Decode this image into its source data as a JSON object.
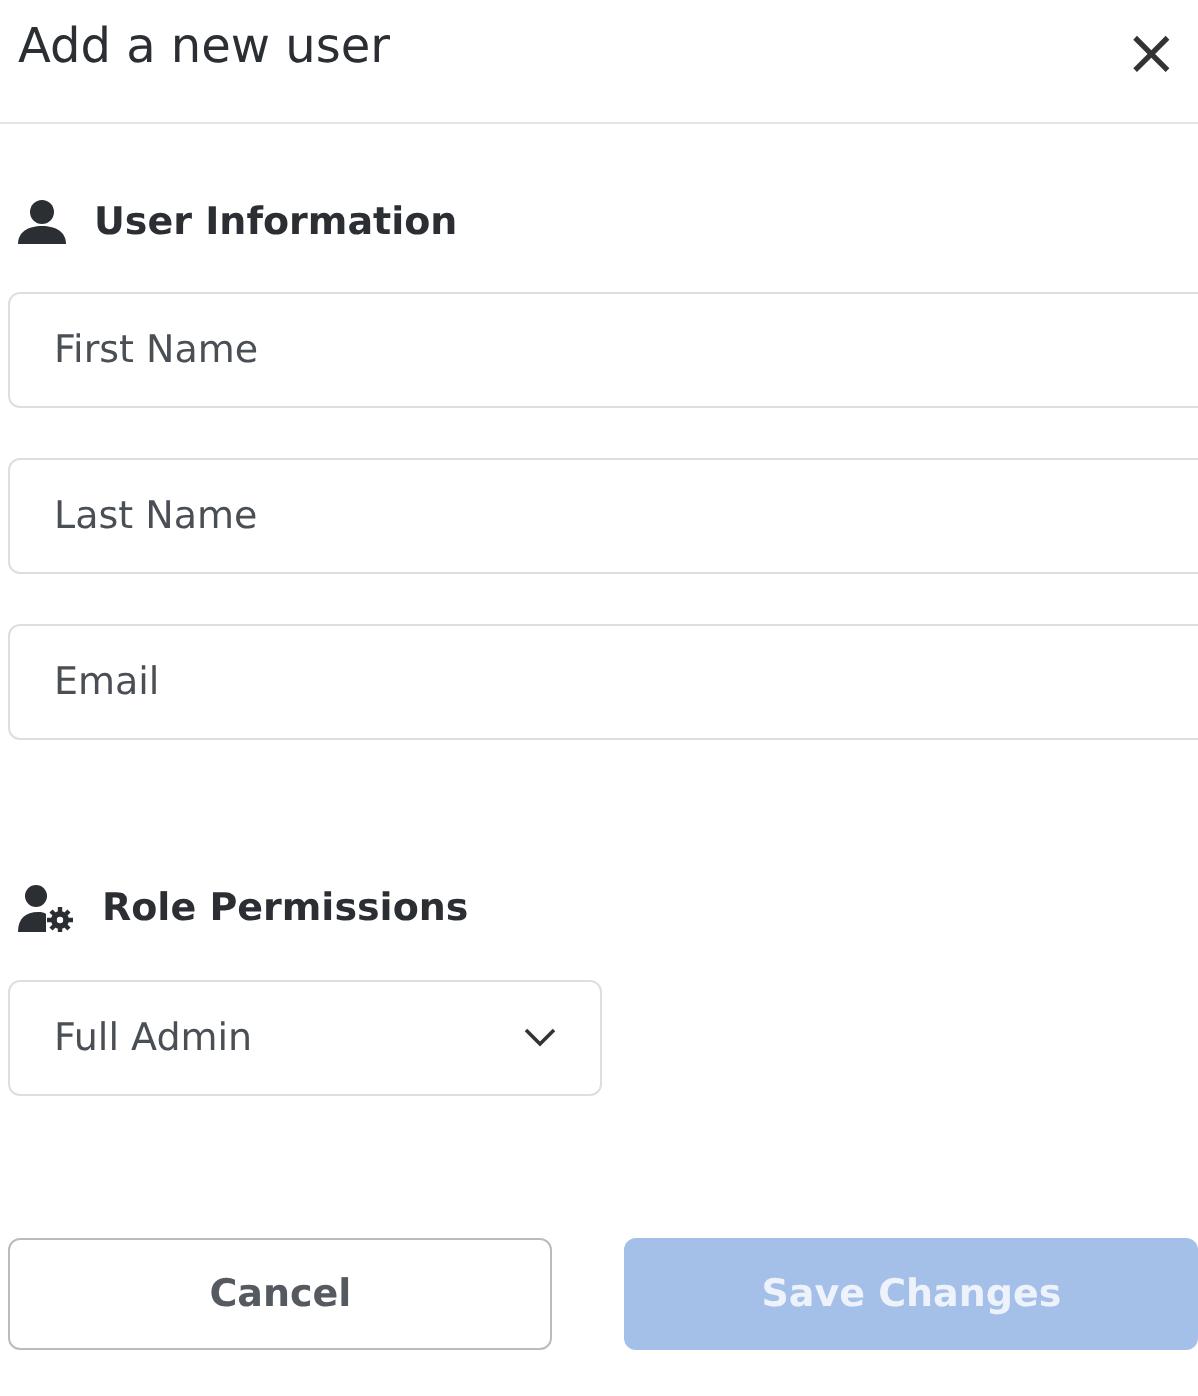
{
  "dialog": {
    "title": "Add a new user",
    "close": "×"
  },
  "user_information": {
    "heading": "User Information",
    "fields": [
      {
        "placeholder": "First Name"
      },
      {
        "placeholder": "Last Name"
      },
      {
        "placeholder": "Email"
      }
    ]
  },
  "role_permissions": {
    "heading": "Role Permissions",
    "select": {
      "value": "Full Admin"
    }
  },
  "buttons": [
    {
      "kind": "secondary",
      "label": "Cancel",
      "disabled": false
    },
    {
      "kind": "primary",
      "label": "Save Changes",
      "disabled": true
    }
  ]
}
